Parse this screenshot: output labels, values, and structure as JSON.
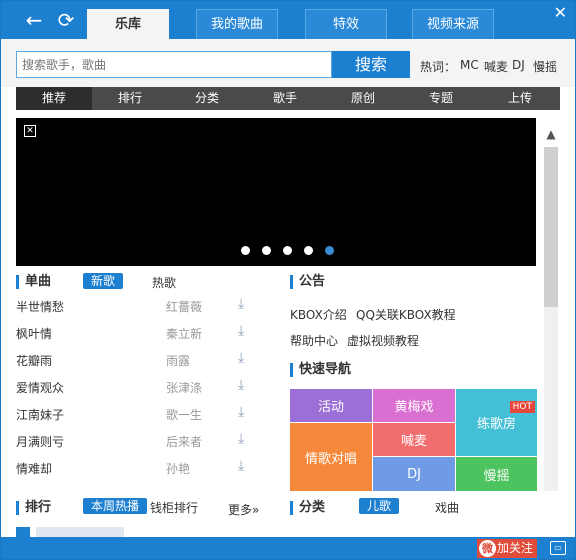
{
  "titlebar": {
    "tabs": [
      {
        "label": "乐库",
        "active": true
      },
      {
        "label": "我的歌曲",
        "active": false
      },
      {
        "label": "特效",
        "active": false
      },
      {
        "label": "视频来源",
        "active": false
      }
    ],
    "back_icon": "back-arrow-icon",
    "refresh_icon": "refresh-icon",
    "close_icon": "close-icon"
  },
  "search": {
    "placeholder": "搜索歌手，歌曲",
    "button_label": "搜索",
    "hot_label": "热词：",
    "hot_words": [
      "MC",
      "喊麦",
      "DJ",
      "慢摇"
    ]
  },
  "catnav": {
    "items": [
      "推荐",
      "排行",
      "分类",
      "歌手",
      "原创",
      "专题",
      "上传"
    ],
    "active_index": 0
  },
  "banner": {
    "dots": 5,
    "active_dot": 4
  },
  "singles": {
    "title": "单曲",
    "tabs": [
      "新歌",
      "热歌"
    ],
    "songs": [
      {
        "name": "半世情愁",
        "artist": "红薔薇"
      },
      {
        "name": "枫叶情",
        "artist": "秦立新"
      },
      {
        "name": "花瓣雨",
        "artist": "雨露"
      },
      {
        "name": "爱情观众",
        "artist": "张津涤"
      },
      {
        "name": "江南妹子",
        "artist": "歌一生"
      },
      {
        "name": "月满则亏",
        "artist": "后来者"
      },
      {
        "name": "情难却",
        "artist": "孙艳"
      }
    ]
  },
  "ranking": {
    "title": "排行",
    "tabs": [
      "本周热播",
      "钱柜排行"
    ],
    "more": "更多»"
  },
  "notice": {
    "title": "公告",
    "links": [
      "KBOX介绍",
      "QQ关联KBOX教程",
      "帮助中心",
      "虚拟视频教程"
    ]
  },
  "quicknav": {
    "title": "快速导航",
    "tiles": [
      {
        "label": "活动",
        "color": "#9b6fd6"
      },
      {
        "label": "黄梅戏",
        "color": "#d96fd0"
      },
      {
        "label": "练歌房",
        "color": "#43bfd6"
      },
      {
        "label": "情歌对唱",
        "color": "#f5883a"
      },
      {
        "label": "喊麦",
        "color": "#f26d6d"
      },
      {
        "label": "DJ",
        "color": "#6f9be6"
      },
      {
        "label": "慢摇",
        "color": "#4cc35e"
      }
    ],
    "hot_badge": "HOT"
  },
  "category": {
    "title": "分类",
    "tabs": [
      "儿歌",
      "戏曲"
    ]
  },
  "footer": {
    "follow_label": "加关注",
    "weibo_icon": "weibo-icon",
    "chat_icon": "chat-icon"
  }
}
